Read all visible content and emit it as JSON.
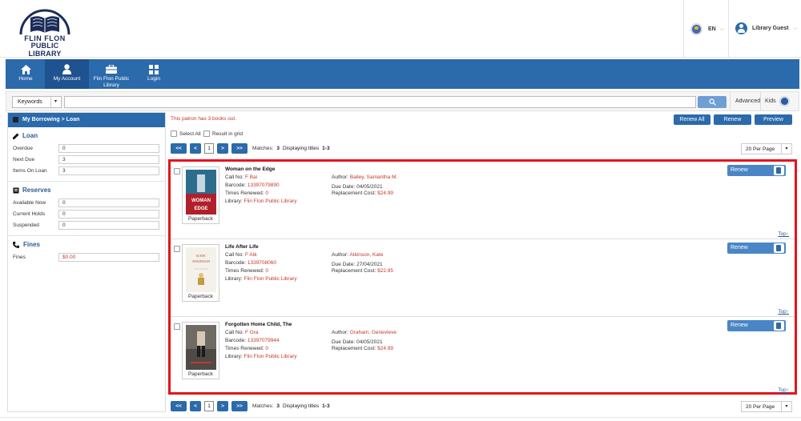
{
  "logo": {
    "line1": "FLIN FLON",
    "line2": "PUBLIC LIBRARY"
  },
  "header": {
    "language": "EN",
    "user": "Library Guest"
  },
  "nav": {
    "items": [
      {
        "label": "Home",
        "icon": "home-icon"
      },
      {
        "label": "My Account",
        "icon": "person-icon"
      },
      {
        "label": "Flin Flon Public Library",
        "icon": "briefcase-icon"
      },
      {
        "label": "Login",
        "icon": "grid-icon"
      }
    ]
  },
  "search": {
    "scope": "Keywords",
    "value": "",
    "advanced": "Advanced",
    "kids": "Kids"
  },
  "sidebar": {
    "breadcrumb": "My Borrowing > Loan",
    "loan": {
      "title": "Loan",
      "rows": [
        {
          "label": "Overdue",
          "value": "0"
        },
        {
          "label": "Next Due",
          "value": "3"
        },
        {
          "label": "Items On Loan",
          "value": "3"
        }
      ]
    },
    "reserves": {
      "title": "Reserves",
      "rows": [
        {
          "label": "Available Now",
          "value": "0"
        },
        {
          "label": "Current Holds",
          "value": "0"
        },
        {
          "label": "Suspended",
          "value": "0"
        }
      ]
    },
    "fines": {
      "title": "Fines",
      "rows": [
        {
          "label": "Fines",
          "value": "$0.00"
        }
      ]
    }
  },
  "content": {
    "notice": "This patron has 3 books out.",
    "renew_all": "Renew All",
    "renew": "Renew",
    "preview": "Preview",
    "select_all": "Select All",
    "result_grid": "Result in grid",
    "pager": {
      "first": "<<",
      "prev": "<",
      "page": "1",
      "next": ">",
      "last": ">>",
      "matches_label": "Matches:",
      "matches": "3",
      "displaying_label": "Displaying titles",
      "displaying": "1-3"
    },
    "per_page": "20 Per Page",
    "labels": {
      "call_no": "Call No:",
      "barcode": "Barcode:",
      "times_renewed": "Times Renewed:",
      "library": "Library:",
      "author": "Author:",
      "due_date": "Due Date:",
      "replacement_cost": "Replacement Cost:",
      "renew": "Renew",
      "top": "Top↑"
    },
    "items": [
      {
        "title": "Woman on the Edge",
        "format": "Paperback",
        "call_no": "F Bai",
        "barcode": "13397079890",
        "times_renewed": "0",
        "library": "Flin Flon Public Library",
        "author": "Bailey, Samantha M.",
        "due_date": "04/05/2021",
        "replacement_cost": "$24.99",
        "cover_text1": "WOMAN",
        "cover_text2": "EDGE"
      },
      {
        "title": "Life After Life",
        "format": "Paperback",
        "call_no": "F Atk",
        "barcode": "1339708060",
        "times_renewed": "0",
        "library": "Flin Flon Public Library",
        "author": "Atkinson, Kate",
        "due_date": "27/04/2021",
        "replacement_cost": "$22.95",
        "cover_text1": "KATE",
        "cover_text2": "ATKINSON"
      },
      {
        "title": "Forgotten Home Child, The",
        "format": "Paperback",
        "call_no": "F Gra",
        "barcode": "13397079944",
        "times_renewed": "0",
        "library": "Flin Flon Public Library",
        "author": "Graham, Genevieve",
        "due_date": "04/05/2021",
        "replacement_cost": "$24.99",
        "cover_text1": "",
        "cover_text2": ""
      }
    ]
  },
  "colors": {
    "primary": "#2b6aab",
    "accent_red": "#c0392b",
    "highlight": "#e8121e"
  }
}
